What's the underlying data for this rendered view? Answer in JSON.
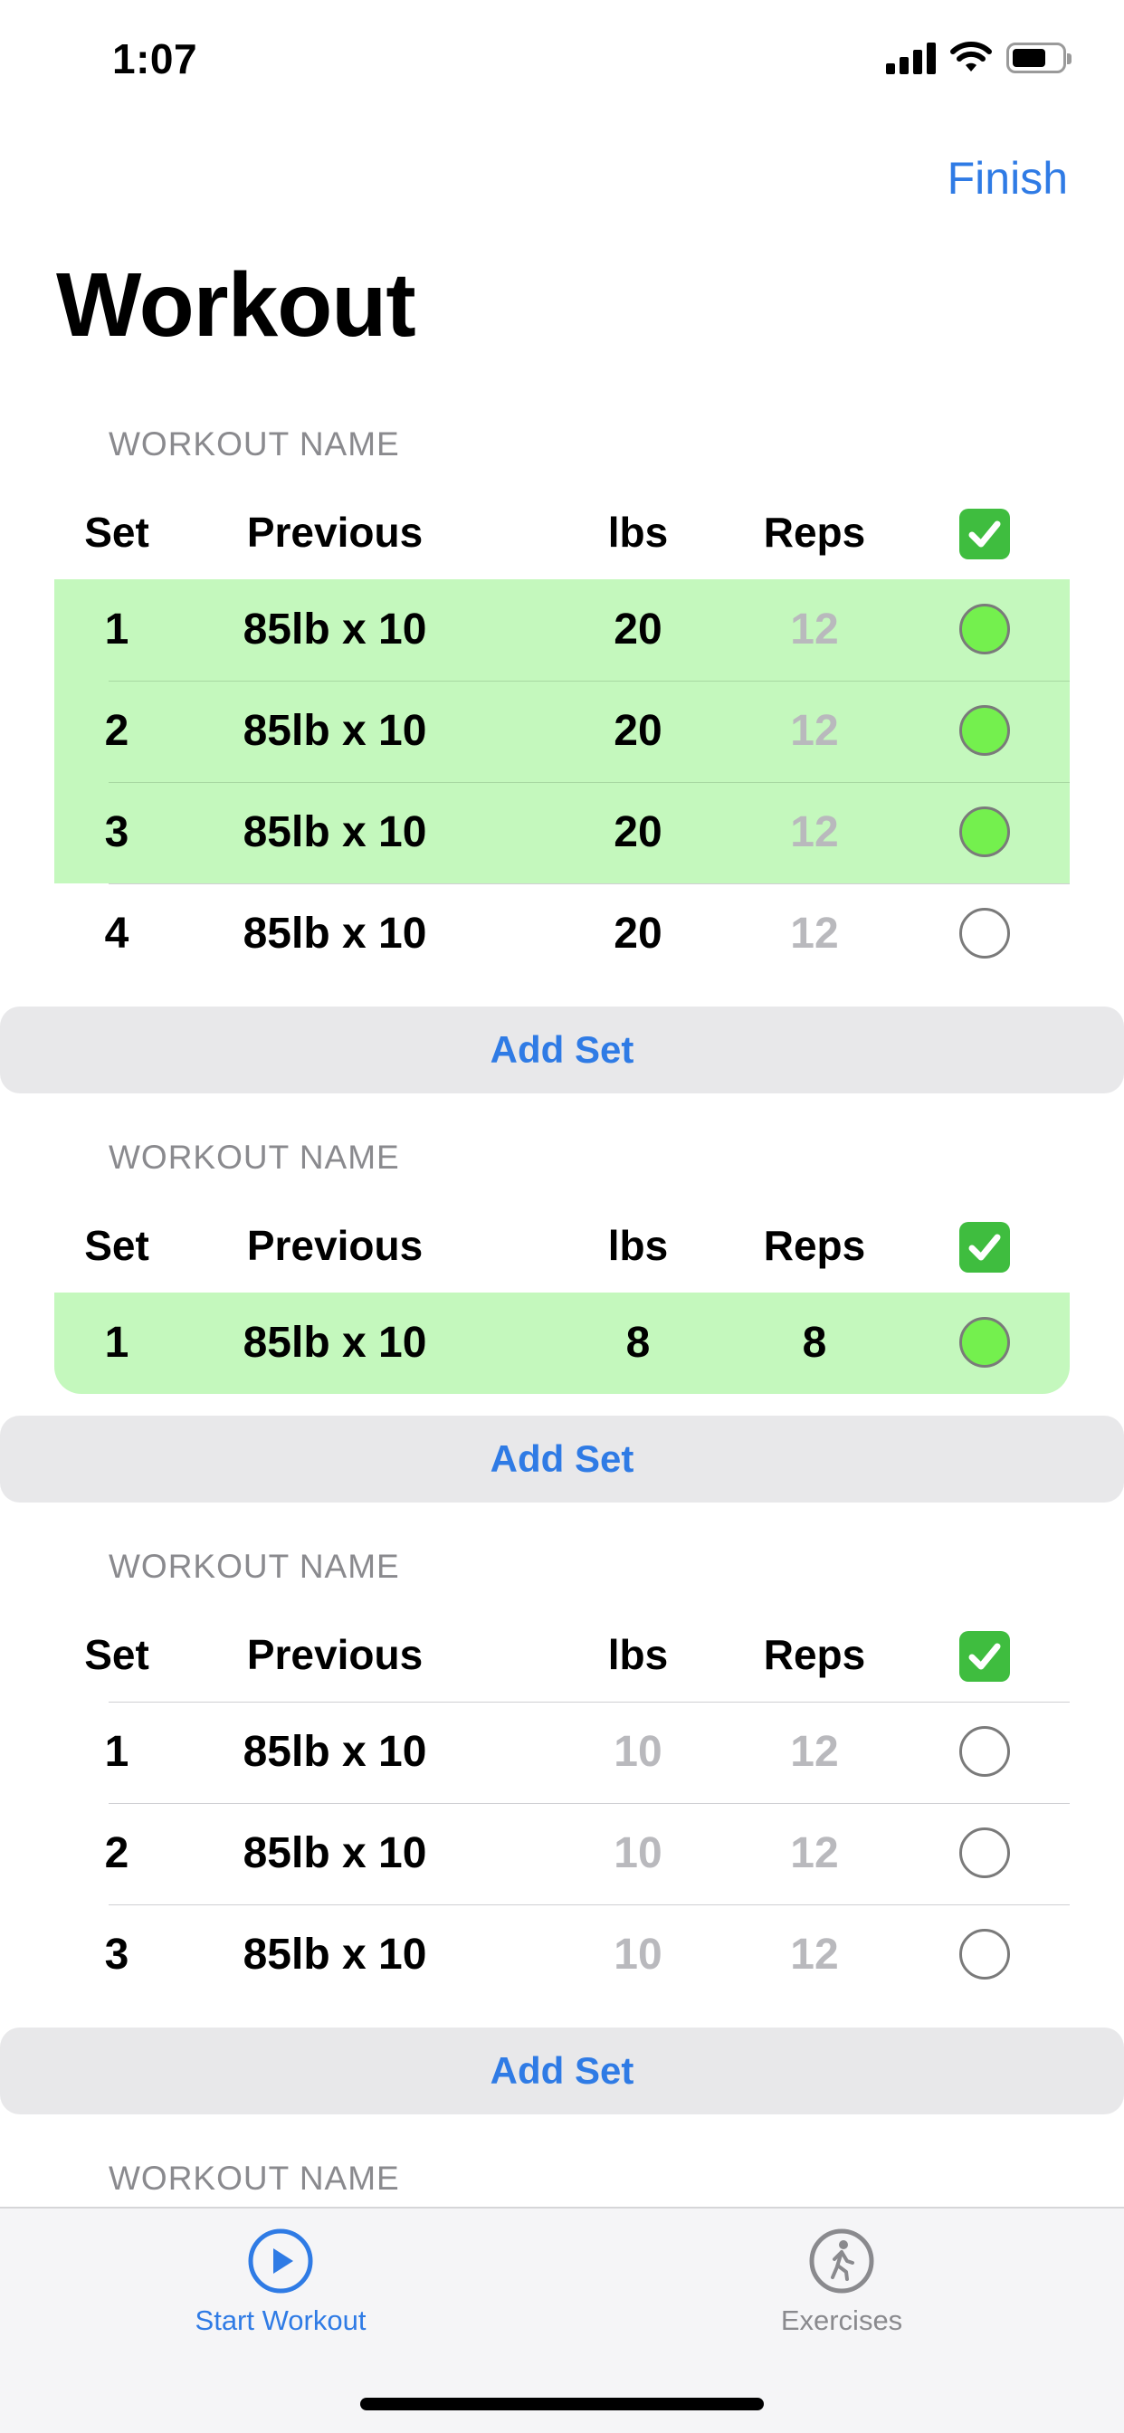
{
  "status": {
    "time": "1:07"
  },
  "nav": {
    "finish_label": "Finish",
    "title": "Workout"
  },
  "table_header": {
    "set": "Set",
    "previous": "Previous",
    "lbs": "lbs",
    "reps": "Reps",
    "check_icon": "white-check-mark-on-green-icon"
  },
  "exercises": [
    {
      "label": "WORKOUT NAME",
      "sets": [
        {
          "set": "1",
          "previous": "85lb x 10",
          "lbs": "20",
          "reps": "12",
          "completed": true
        },
        {
          "set": "2",
          "previous": "85lb x 10",
          "lbs": "20",
          "reps": "12",
          "completed": true
        },
        {
          "set": "3",
          "previous": "85lb x 10",
          "lbs": "20",
          "reps": "12",
          "completed": true
        },
        {
          "set": "4",
          "previous": "85lb x 10",
          "lbs": "20",
          "reps": "12",
          "completed": false
        }
      ],
      "add_set_label": "Add Set"
    },
    {
      "label": "WORKOUT NAME",
      "sets": [
        {
          "set": "1",
          "previous": "85lb x 10",
          "lbs": "8",
          "reps": "8",
          "completed": true
        }
      ],
      "add_set_label": "Add Set"
    },
    {
      "label": "WORKOUT NAME",
      "sets": [
        {
          "set": "1",
          "previous": "85lb x 10",
          "lbs": "10",
          "reps": "12",
          "completed": false
        },
        {
          "set": "2",
          "previous": "85lb x 10",
          "lbs": "10",
          "reps": "12",
          "completed": false
        },
        {
          "set": "3",
          "previous": "85lb x 10",
          "lbs": "10",
          "reps": "12",
          "completed": false
        }
      ],
      "add_set_label": "Add Set"
    },
    {
      "label": "WORKOUT NAME",
      "sets": []
    }
  ],
  "tab_bar": {
    "items": [
      {
        "label": "Start Workout",
        "icon": "play-circle-icon",
        "selected": true
      },
      {
        "label": "Exercises",
        "icon": "walking-figure-icon",
        "selected": false
      }
    ]
  },
  "colors": {
    "accent": "#2f7be5",
    "completed_row": "#c4f8bd",
    "completed_circle": "#74f04e",
    "placeholder_text": "#b9b9bd"
  }
}
